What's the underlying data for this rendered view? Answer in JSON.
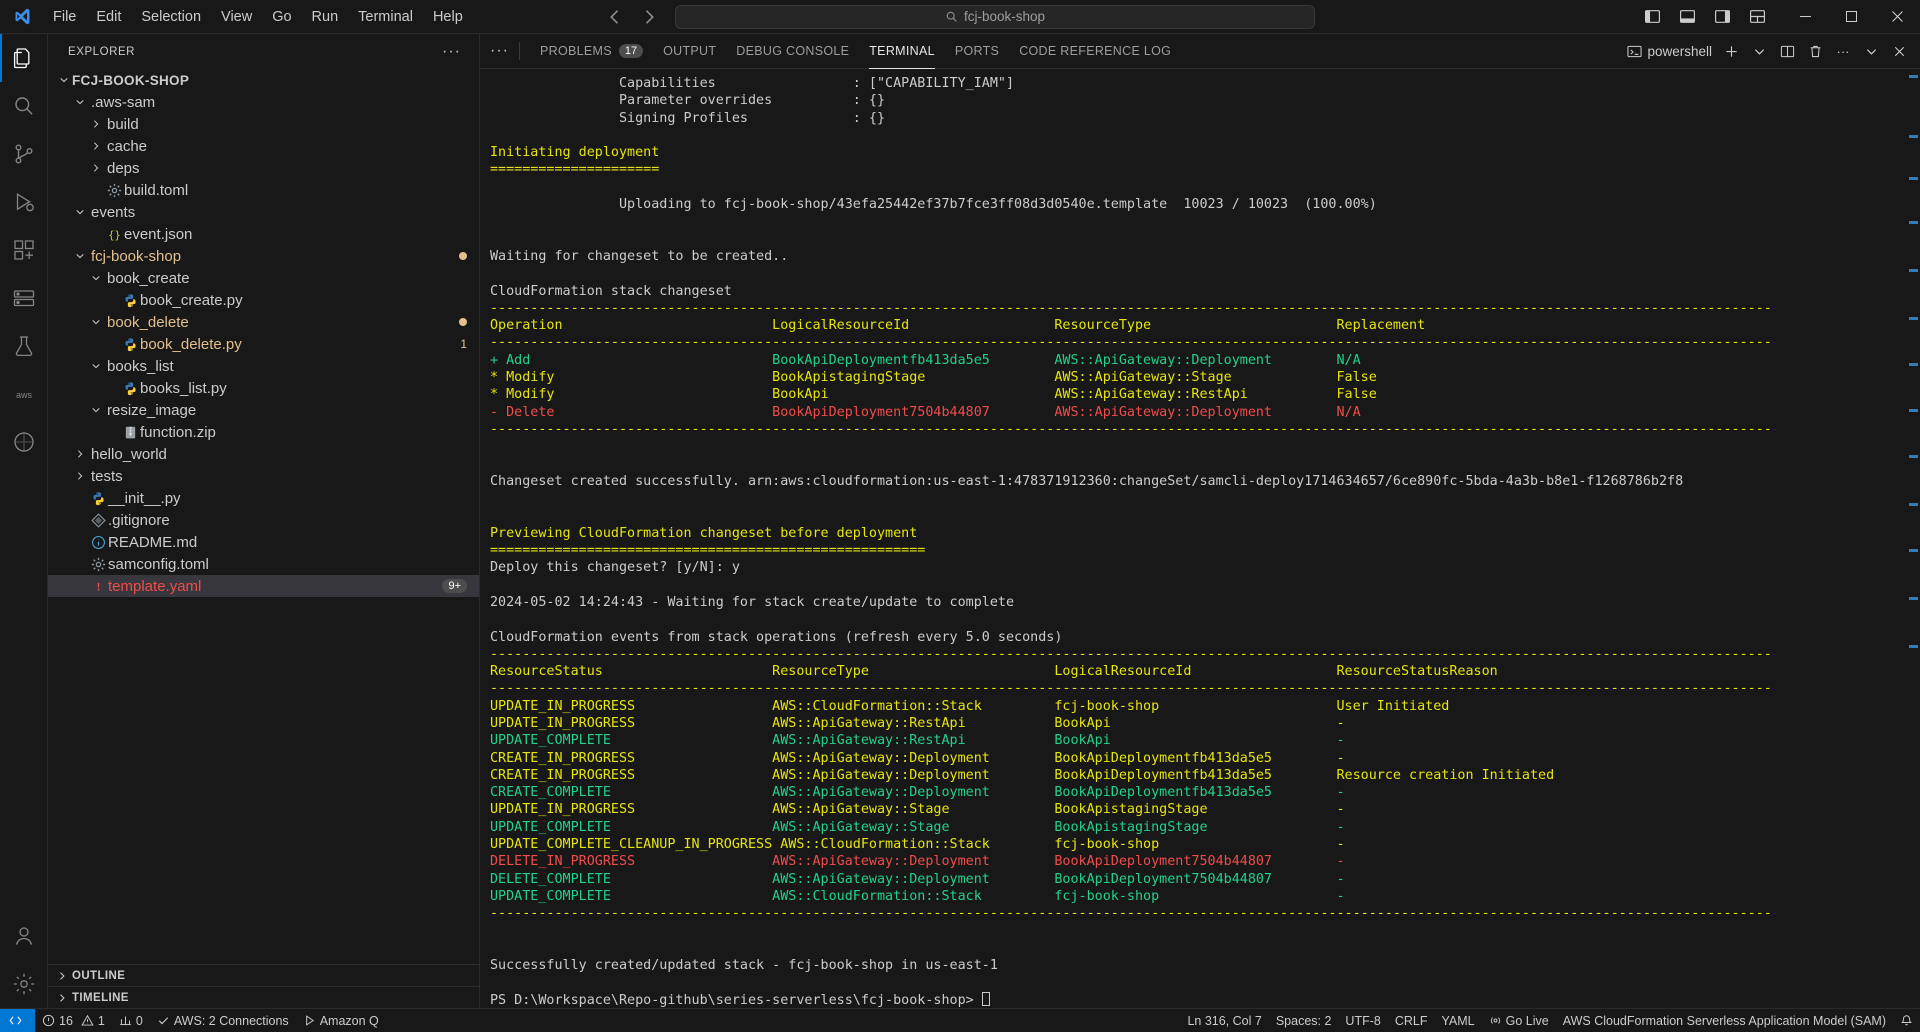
{
  "titlebar": {
    "menus": [
      "File",
      "Edit",
      "Selection",
      "View",
      "Go",
      "Run",
      "Terminal",
      "Help"
    ],
    "search_placeholder": "fcj-book-shop",
    "back_label": "←",
    "forward_label": "→"
  },
  "activitybar": {
    "items": [
      {
        "name": "explorer",
        "label": "Explorer"
      },
      {
        "name": "search",
        "label": "Search"
      },
      {
        "name": "source-control",
        "label": "Source Control"
      },
      {
        "name": "run-debug",
        "label": "Run and Debug"
      },
      {
        "name": "extensions",
        "label": "Extensions"
      },
      {
        "name": "remote-explorer",
        "label": "Remote Explorer"
      },
      {
        "name": "testing",
        "label": "Testing"
      },
      {
        "name": "aws-toolkit",
        "label": "AWS"
      },
      {
        "name": "docker",
        "label": "Docker"
      }
    ],
    "bottom": [
      {
        "name": "accounts",
        "label": "Accounts"
      },
      {
        "name": "settings",
        "label": "Manage"
      }
    ]
  },
  "sidebar": {
    "title": "EXPLORER",
    "more_actions": "···",
    "tree": [
      {
        "label": "FCJ-BOOK-SHOP",
        "indent": 0,
        "type": "root",
        "twisty": "down",
        "color": "root"
      },
      {
        "label": ".aws-sam",
        "indent": 1,
        "type": "folder",
        "twisty": "down",
        "color": "plain"
      },
      {
        "label": "build",
        "indent": 2,
        "type": "folder",
        "twisty": "right",
        "color": "plain"
      },
      {
        "label": "cache",
        "indent": 2,
        "type": "folder",
        "twisty": "right",
        "color": "plain"
      },
      {
        "label": "deps",
        "indent": 2,
        "type": "folder",
        "twisty": "right",
        "color": "plain"
      },
      {
        "label": "build.toml",
        "indent": 2,
        "type": "file",
        "icon": "gear",
        "color": "plain"
      },
      {
        "label": "events",
        "indent": 1,
        "type": "folder",
        "twisty": "down",
        "color": "plain"
      },
      {
        "label": "event.json",
        "indent": 2,
        "type": "file",
        "icon": "json",
        "color": "plain"
      },
      {
        "label": "fcj-book-shop",
        "indent": 1,
        "type": "folder",
        "twisty": "down",
        "color": "yellow",
        "badge": "dot"
      },
      {
        "label": "book_create",
        "indent": 2,
        "type": "folder",
        "twisty": "down",
        "color": "plain"
      },
      {
        "label": "book_create.py",
        "indent": 3,
        "type": "file",
        "icon": "python",
        "color": "plain"
      },
      {
        "label": "book_delete",
        "indent": 2,
        "type": "folder",
        "twisty": "down",
        "color": "yellow",
        "badge": "dot"
      },
      {
        "label": "book_delete.py",
        "indent": 3,
        "type": "file",
        "icon": "python",
        "color": "yellow",
        "badge": "1"
      },
      {
        "label": "books_list",
        "indent": 2,
        "type": "folder",
        "twisty": "down",
        "color": "plain"
      },
      {
        "label": "books_list.py",
        "indent": 3,
        "type": "file",
        "icon": "python",
        "color": "plain"
      },
      {
        "label": "resize_image",
        "indent": 2,
        "type": "folder",
        "twisty": "down",
        "color": "plain"
      },
      {
        "label": "function.zip",
        "indent": 3,
        "type": "file",
        "icon": "zip",
        "color": "plain"
      },
      {
        "label": "hello_world",
        "indent": 1,
        "type": "folder",
        "twisty": "right",
        "color": "plain"
      },
      {
        "label": "tests",
        "indent": 1,
        "type": "folder",
        "twisty": "right",
        "color": "plain"
      },
      {
        "label": "__init__.py",
        "indent": 1,
        "type": "file",
        "icon": "python",
        "color": "plain"
      },
      {
        "label": ".gitignore",
        "indent": 1,
        "type": "file",
        "icon": "git",
        "color": "plain"
      },
      {
        "label": "README.md",
        "indent": 1,
        "type": "file",
        "icon": "info",
        "color": "plain"
      },
      {
        "label": "samconfig.toml",
        "indent": 1,
        "type": "file",
        "icon": "gear",
        "color": "plain"
      },
      {
        "label": "template.yaml",
        "indent": 1,
        "type": "file",
        "icon": "warn",
        "color": "red",
        "selected": true,
        "badge": "9+"
      }
    ],
    "sections": [
      {
        "label": "OUTLINE"
      },
      {
        "label": "TIMELINE"
      }
    ]
  },
  "panel": {
    "tabs": [
      {
        "label": "PROBLEMS",
        "count": "17",
        "active": false
      },
      {
        "label": "OUTPUT",
        "count": "",
        "active": false
      },
      {
        "label": "DEBUG CONSOLE",
        "count": "",
        "active": false
      },
      {
        "label": "TERMINAL",
        "count": "",
        "active": true
      },
      {
        "label": "PORTS",
        "count": "",
        "active": false
      },
      {
        "label": "CODE REFERENCE LOG",
        "count": "",
        "active": false
      }
    ],
    "actions": {
      "shell_name": "powershell",
      "new_terminal": "+",
      "split": "split-terminal",
      "kill": "trash",
      "more": "···",
      "maximize": "chevron-up",
      "close": "✕"
    }
  },
  "terminal": {
    "lines": [
      [
        {
          "t": "                Capabilities                 : [\"CAPABILITY_IAM\"]",
          "c": "w"
        }
      ],
      [
        {
          "t": "                Parameter overrides          : {}",
          "c": "w"
        }
      ],
      [
        {
          "t": "                Signing Profiles             : {}",
          "c": "w"
        }
      ],
      [
        {
          "t": "",
          "c": "w"
        }
      ],
      [
        {
          "t": "Initiating deployment",
          "c": "y"
        }
      ],
      [
        {
          "t": "=====================",
          "c": "y"
        }
      ],
      [
        {
          "t": "",
          "c": "w"
        }
      ],
      [
        {
          "t": "                Uploading to fcj-book-shop/43efa25442ef37b7fce3ff08d3d0540e.template  10023 / 10023  (100.00%)",
          "c": "w"
        }
      ],
      [
        {
          "t": "",
          "c": "w"
        }
      ],
      [
        {
          "t": "",
          "c": "w"
        }
      ],
      [
        {
          "t": "Waiting for changeset to be created..",
          "c": "w"
        }
      ],
      [
        {
          "t": "",
          "c": "w"
        }
      ],
      [
        {
          "t": "CloudFormation stack changeset",
          "c": "w"
        }
      ],
      [
        {
          "t": "---------------------------------------------------------------------------------------------------------------------------------------------------------------",
          "c": "y"
        }
      ],
      [
        {
          "t": "Operation                          LogicalResourceId                  ResourceType                       Replacement",
          "c": "y"
        }
      ],
      [
        {
          "t": "---------------------------------------------------------------------------------------------------------------------------------------------------------------",
          "c": "y"
        }
      ],
      [
        {
          "t": "+ Add                              BookApiDeploymentfb413da5e5        AWS::ApiGateway::Deployment        N/A",
          "c": "g"
        }
      ],
      [
        {
          "t": "* Modify                           BookApistagingStage                AWS::ApiGateway::Stage             False",
          "c": "y"
        }
      ],
      [
        {
          "t": "* Modify                           BookApi                            AWS::ApiGateway::RestApi           False",
          "c": "y"
        }
      ],
      [
        {
          "t": "- Delete                           BookApiDeployment7504b44807        AWS::ApiGateway::Deployment        N/A",
          "c": "r"
        }
      ],
      [
        {
          "t": "---------------------------------------------------------------------------------------------------------------------------------------------------------------",
          "c": "y"
        }
      ],
      [
        {
          "t": "",
          "c": "w"
        }
      ],
      [
        {
          "t": "",
          "c": "w"
        }
      ],
      [
        {
          "t": "Changeset created successfully. arn:aws:cloudformation:us-east-1:478371912360:changeSet/samcli-deploy1714634657/6ce890fc-5bda-4a3b-b8e1-f1268786b2f8",
          "c": "w"
        }
      ],
      [
        {
          "t": "",
          "c": "w"
        }
      ],
      [
        {
          "t": "",
          "c": "w"
        }
      ],
      [
        {
          "t": "Previewing CloudFormation changeset before deployment",
          "c": "y"
        }
      ],
      [
        {
          "t": "======================================================",
          "c": "y"
        }
      ],
      [
        {
          "t": "Deploy this changeset? [y/N]: y",
          "c": "w"
        }
      ],
      [
        {
          "t": "",
          "c": "w"
        }
      ],
      [
        {
          "t": "2024-05-02 14:24:43 - Waiting for stack create/update to complete",
          "c": "w"
        }
      ],
      [
        {
          "t": "",
          "c": "w"
        }
      ],
      [
        {
          "t": "CloudFormation events from stack operations (refresh every 5.0 seconds)",
          "c": "w"
        }
      ],
      [
        {
          "t": "---------------------------------------------------------------------------------------------------------------------------------------------------------------",
          "c": "y"
        }
      ],
      [
        {
          "t": "ResourceStatus                     ResourceType                       LogicalResourceId                  ResourceStatusReason",
          "c": "y"
        }
      ],
      [
        {
          "t": "---------------------------------------------------------------------------------------------------------------------------------------------------------------",
          "c": "y"
        }
      ],
      [
        {
          "t": "UPDATE_IN_PROGRESS                 AWS::CloudFormation::Stack         fcj-book-shop                      User Initiated",
          "c": "y"
        }
      ],
      [
        {
          "t": "UPDATE_IN_PROGRESS                 AWS::ApiGateway::RestApi           BookApi                            -",
          "c": "y"
        }
      ],
      [
        {
          "t": "UPDATE_COMPLETE                    AWS::ApiGateway::RestApi           BookApi                            -",
          "c": "g"
        }
      ],
      [
        {
          "t": "CREATE_IN_PROGRESS                 AWS::ApiGateway::Deployment        BookApiDeploymentfb413da5e5        -",
          "c": "y"
        }
      ],
      [
        {
          "t": "CREATE_IN_PROGRESS                 AWS::ApiGateway::Deployment        BookApiDeploymentfb413da5e5        Resource creation Initiated",
          "c": "y"
        }
      ],
      [
        {
          "t": "CREATE_COMPLETE                    AWS::ApiGateway::Deployment        BookApiDeploymentfb413da5e5        -",
          "c": "g"
        }
      ],
      [
        {
          "t": "UPDATE_IN_PROGRESS                 AWS::ApiGateway::Stage             BookApistagingStage                -",
          "c": "y"
        }
      ],
      [
        {
          "t": "UPDATE_COMPLETE                    AWS::ApiGateway::Stage             BookApistagingStage                -",
          "c": "g"
        }
      ],
      [
        {
          "t": "UPDATE_COMPLETE_CLEANUP_IN_PROGRESS AWS::CloudFormation::Stack        fcj-book-shop                      -",
          "c": "y"
        }
      ],
      [
        {
          "t": "DELETE_IN_PROGRESS                 AWS::ApiGateway::Deployment        BookApiDeployment7504b44807        -",
          "c": "r"
        }
      ],
      [
        {
          "t": "DELETE_COMPLETE                    AWS::ApiGateway::Deployment        BookApiDeployment7504b44807        -",
          "c": "g"
        }
      ],
      [
        {
          "t": "UPDATE_COMPLETE                    AWS::CloudFormation::Stack         fcj-book-shop                      -",
          "c": "g"
        }
      ],
      [
        {
          "t": "---------------------------------------------------------------------------------------------------------------------------------------------------------------",
          "c": "y"
        }
      ],
      [
        {
          "t": "",
          "c": "w"
        }
      ],
      [
        {
          "t": "",
          "c": "w"
        }
      ],
      [
        {
          "t": "Successfully created/updated stack - fcj-book-shop in us-east-1",
          "c": "w"
        }
      ],
      [
        {
          "t": "",
          "c": "w"
        }
      ],
      [
        {
          "t": "PS D:\\Workspace\\Repo-github\\series-serverless\\fcj-book-shop> ",
          "c": "w",
          "prompt": true
        }
      ]
    ]
  },
  "statusbar": {
    "remote_label": "",
    "left": [
      {
        "name": "problems",
        "icon": "error-circle",
        "label": "16",
        "label2": "1"
      },
      {
        "name": "ports-forwarded",
        "icon": "ports",
        "label": "0"
      },
      {
        "name": "aws-connections",
        "icon": "check",
        "label": "AWS: 2 Connections"
      },
      {
        "name": "amazon-q",
        "icon": "play",
        "label": "Amazon Q"
      }
    ],
    "right": [
      {
        "name": "line-col",
        "label": "Ln 316, Col 7"
      },
      {
        "name": "indentation",
        "label": "Spaces: 2"
      },
      {
        "name": "encoding",
        "label": "UTF-8"
      },
      {
        "name": "eol",
        "label": "CRLF"
      },
      {
        "name": "language-mode",
        "label": "YAML"
      },
      {
        "name": "go-live",
        "label": "Go Live",
        "icon": "broadcast"
      },
      {
        "name": "sam-status",
        "label": "AWS CloudFormation Serverless Application Model (SAM)"
      },
      {
        "name": "notifications",
        "label": "",
        "icon": "bell"
      }
    ]
  },
  "colors": {
    "accent": "#0078d4",
    "terminal_bg": "#181818",
    "yellow": "#e5e510",
    "green": "#23d18b",
    "red": "#f14c4c"
  }
}
